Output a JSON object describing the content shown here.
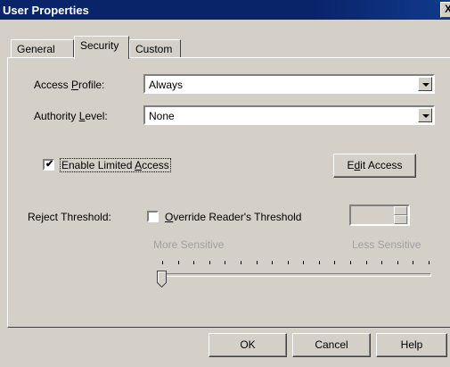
{
  "window": {
    "title": "User Properties",
    "close_label": "X"
  },
  "tabs": [
    {
      "label": "General"
    },
    {
      "label": "Security",
      "active": true
    },
    {
      "label": "Custom"
    }
  ],
  "access_profile": {
    "label_pre": "Access ",
    "label_ul": "P",
    "label_post": "rofile:",
    "value": "Always"
  },
  "authority_level": {
    "label_pre": "Authority ",
    "label_ul": "L",
    "label_post": "evel:",
    "value": "None"
  },
  "limited_access": {
    "checked": true,
    "label_pre": "Enable Limited ",
    "label_ul": "A",
    "label_post": "ccess"
  },
  "edit_access": {
    "label_pre": "E",
    "label_ul": "d",
    "label_post": "it Access"
  },
  "reject_threshold": {
    "label": "Reject Threshold:",
    "override_checked": false,
    "override_label_ul": "O",
    "override_label_post": "verride Reader's Threshold",
    "spin_value": ""
  },
  "slider": {
    "min_label": "More Sensitive",
    "max_label": "Less Sensitive",
    "tick_count": 18,
    "position": 0
  },
  "footer": {
    "ok": "OK",
    "cancel": "Cancel",
    "help": "Help"
  },
  "colors": {
    "titlebar": "#0a246a",
    "face": "#d4d0c8",
    "disabled_text": "#a0a0a0"
  }
}
